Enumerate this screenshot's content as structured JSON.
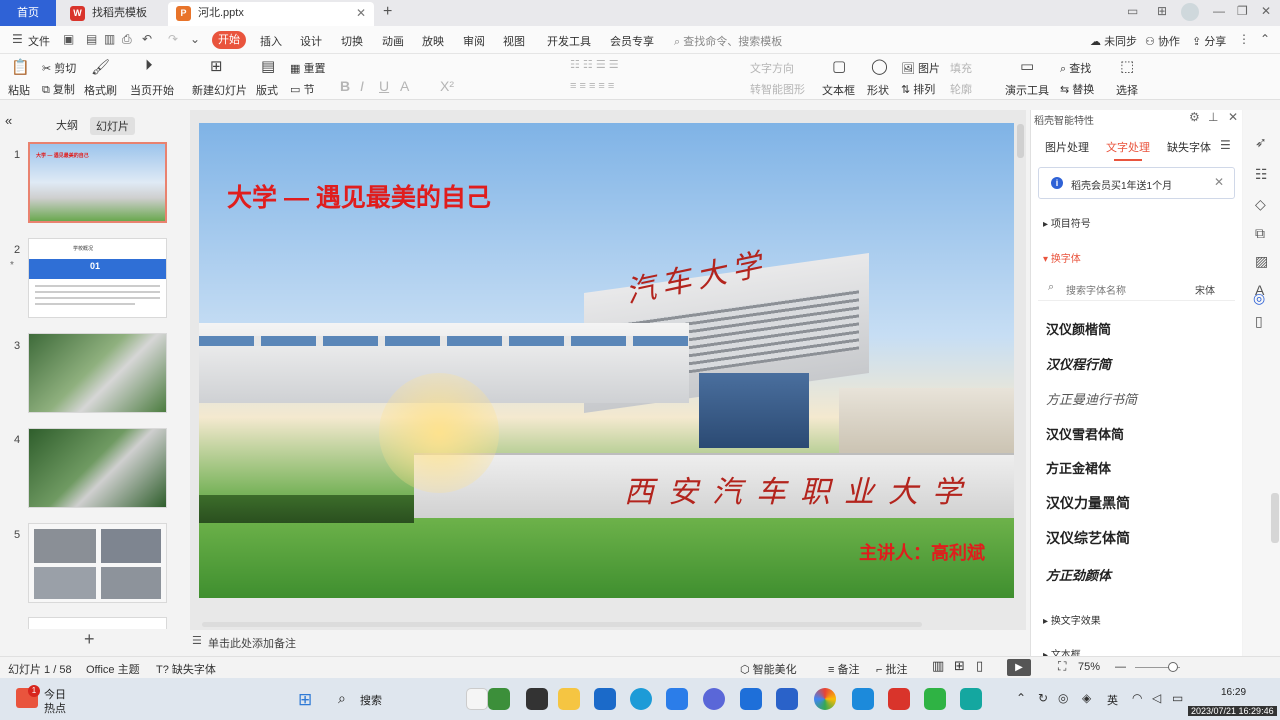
{
  "tabs": {
    "home": "首页",
    "docs": [
      {
        "title": "找稻壳模板",
        "badge": "W",
        "color": "#d9342b",
        "active": false
      },
      {
        "title": "河北.pptx",
        "badge": "P",
        "color": "#e8742a",
        "active": true
      }
    ],
    "close": "✕",
    "add": "+"
  },
  "menu": {
    "file": "文件",
    "items": [
      "开始",
      "插入",
      "设计",
      "切换",
      "动画",
      "放映",
      "审阅",
      "视图",
      "开发工具",
      "会员专享"
    ],
    "search_placeholder": "查找命令、搜索模板",
    "sync": "未同步",
    "collab": "协作",
    "share": "分享"
  },
  "ribbon": {
    "cut": "剪切",
    "copy": "复制",
    "paste": "粘贴",
    "format_painter": "格式刷",
    "play_from_current": "当页开始",
    "new_slide": "新建幻灯片",
    "layout": "版式",
    "reset": "重置",
    "section": "节",
    "text_box": "文本框",
    "shape": "形状",
    "picture": "图片",
    "fill": "填充",
    "arrange": "排列",
    "outline": "轮廓",
    "presentation_tools": "演示工具",
    "find": "查找",
    "replace": "替换",
    "select": "选择",
    "text_direction": "文字方向",
    "smart_shape": "转智能图形"
  },
  "left_pane": {
    "tab_outline": "大纲",
    "tab_slides": "幻灯片",
    "slides": [
      {
        "num": "1",
        "label": "大学 — 遇见最美的自己"
      },
      {
        "num": "2",
        "label": "学校概况"
      },
      {
        "num": "3",
        "label": ""
      },
      {
        "num": "4",
        "label": ""
      },
      {
        "num": "5",
        "label": ""
      }
    ],
    "thumb2_number": "01",
    "add": "+"
  },
  "slide": {
    "title": "大学 — 遇见最美的自己",
    "presenter": "主讲人：高利斌",
    "building_sign": "汽车大学",
    "wall_sign": "西安汽车职业大学"
  },
  "notes": {
    "placeholder": "单击此处添加备注"
  },
  "right_panel": {
    "title": "稻壳智能特性",
    "tabs": [
      "图片处理",
      "文字处理",
      "缺失字体"
    ],
    "notice": "稻壳会员买1年送1个月",
    "section_bullets": "项目符号",
    "section_font": "换字体",
    "font_search_placeholder": "搜索字体名称",
    "current_font": "宋体",
    "fonts": [
      "汉仪颜楷简",
      "汉仪程行简",
      "方正曼迪行书简",
      "汉仪雪君体简",
      "方正金裙体",
      "汉仪力量黑简",
      "汉仪综艺体简",
      "方正劲颜体"
    ],
    "section_effect": "换文字效果",
    "section_textbox": "文本框"
  },
  "status": {
    "slide_count": "幻灯片 1 / 58",
    "theme": "Office 主题",
    "missing_font": "缺失字体",
    "beautify": "智能美化",
    "notes": "备注",
    "comments": "批注",
    "zoom": "75%"
  },
  "taskbar": {
    "weather_title": "今日",
    "weather_sub": "热点",
    "notif_count": "1",
    "search": "搜索",
    "ime": "英",
    "time": "16:29",
    "date": "2023/07/21 16:29:46"
  }
}
